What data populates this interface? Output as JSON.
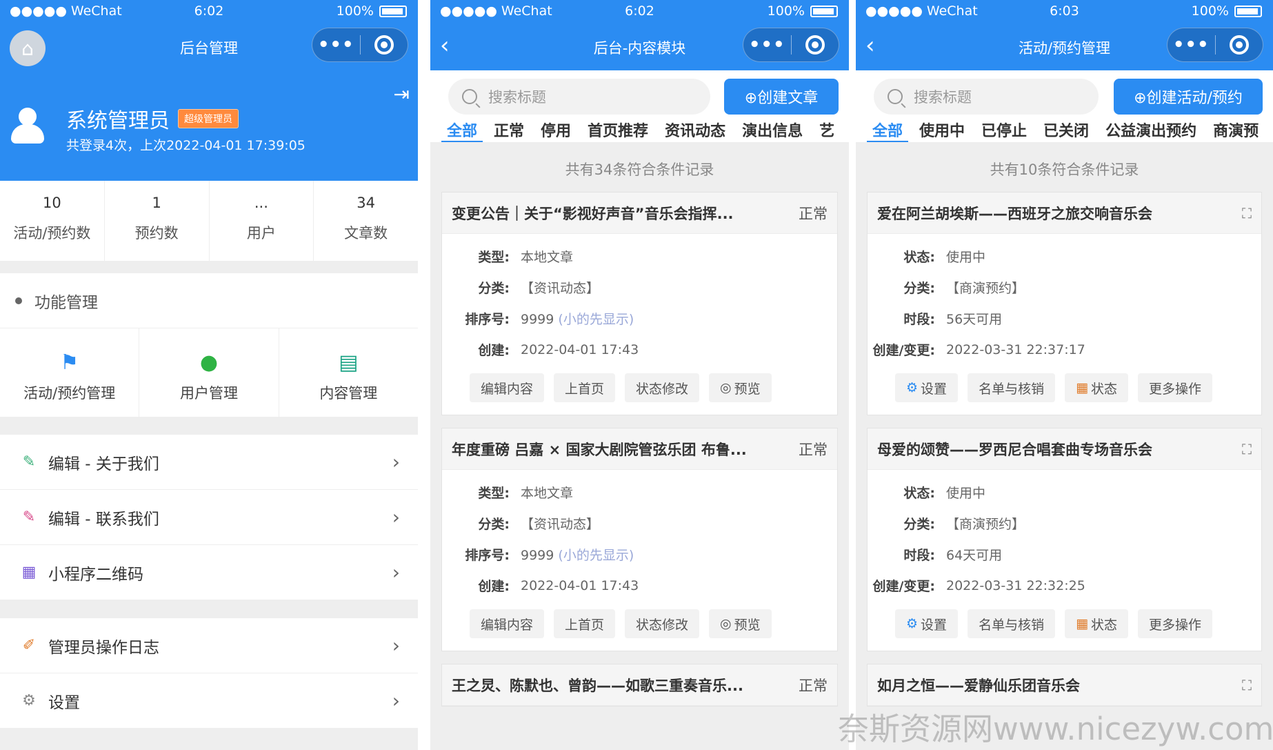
{
  "status_bars": [
    {
      "carrier": "●●●●● WeChat",
      "time": "6:02",
      "battery": "100%"
    },
    {
      "carrier": "●●●●● WeChat",
      "time": "6:02",
      "battery": "100%"
    },
    {
      "carrier": "●●●●● WeChat",
      "time": "6:03",
      "battery": "100%"
    }
  ],
  "capsule": {
    "more": "•••",
    "close": ""
  },
  "p1": {
    "title": "后台管理",
    "user": {
      "name": "系统管理员",
      "badge": "超级管理员",
      "info": "共登录4次，上次2022-04-01 17:39:05"
    },
    "stats": [
      {
        "value": "10",
        "label": "活动/预约数"
      },
      {
        "value": "1",
        "label": "预约数"
      },
      {
        "value": "...",
        "label": "用户"
      },
      {
        "value": "34",
        "label": "文章数"
      }
    ],
    "section": "功能管理",
    "funcs": [
      {
        "label": "活动/预约管理",
        "icon": "flag-icon",
        "color": "#2b8cf2"
      },
      {
        "label": "用户管理",
        "icon": "user-icon",
        "color": "#2fb344"
      },
      {
        "label": "内容管理",
        "icon": "news-icon",
        "color": "#1aa384"
      }
    ],
    "menu1": [
      {
        "label": "编辑 - 关于我们",
        "icon": "edit-icon",
        "color": "#3bb07a"
      },
      {
        "label": "编辑 - 联系我们",
        "icon": "edit-icon",
        "color": "#d84a8a"
      },
      {
        "label": "小程序二维码",
        "icon": "qrcode-icon",
        "color": "#7b5cd6"
      }
    ],
    "menu2": [
      {
        "label": "管理员操作日志",
        "icon": "log-icon",
        "color": "#e07b2a"
      },
      {
        "label": "设置",
        "icon": "gear-icon",
        "color": "#888888"
      }
    ]
  },
  "p2": {
    "title": "后台-内容模块",
    "search_placeholder": "搜索标题",
    "create": "⊕创建文章",
    "tabs": [
      "全部",
      "正常",
      "停用",
      "首页推荐",
      "资讯动态",
      "演出信息",
      "艺"
    ],
    "count": "共有34条符合条件记录",
    "labels": {
      "type": "类型:",
      "cate": "分类:",
      "order": "排序号:",
      "created": "创建:"
    },
    "cards": [
      {
        "title": "变更公告｜关于“影视好声音”音乐会指挥...",
        "status": "正常",
        "type": "本地文章",
        "cate": "【资讯动态】",
        "order": "9999",
        "order_hint": "(小的先显示)",
        "created": "2022-04-01 17:43"
      },
      {
        "title": "年度重磅 吕嘉 × 国家大剧院管弦乐团 布鲁...",
        "status": "正常",
        "type": "本地文章",
        "cate": "【资讯动态】",
        "order": "9999",
        "order_hint": "(小的先显示)",
        "created": "2022-04-01 17:43"
      },
      {
        "title": "王之炅、陈默也、曾韵——如歌三重奏音乐...",
        "status": "正常"
      }
    ],
    "buttons": [
      "编辑内容",
      "上首页",
      "状态修改",
      "预览"
    ]
  },
  "p3": {
    "title": "活动/预约管理",
    "search_placeholder": "搜索标题",
    "create": "⊕创建活动/预约",
    "tabs": [
      "全部",
      "使用中",
      "已停止",
      "已关闭",
      "公益演出预约",
      "商演预"
    ],
    "count": "共有10条符合条件记录",
    "labels": {
      "state": "状态:",
      "cate": "分类:",
      "period": "时段:",
      "changed": "创建/变更:"
    },
    "cards": [
      {
        "title": "爱在阿兰胡埃斯——西班牙之旅交响音乐会",
        "state": "使用中",
        "cate": "【商演预约】",
        "period": "56天可用",
        "changed": "2022-03-31 22:37:17"
      },
      {
        "title": "母爱的颂赞——罗西尼合唱套曲专场音乐会",
        "state": "使用中",
        "cate": "【商演预约】",
        "period": "64天可用",
        "changed": "2022-03-31 22:32:25"
      },
      {
        "title": "如月之恒——爱静仙乐团音乐会"
      }
    ],
    "buttons": [
      "设置",
      "名单与核销",
      "状态",
      "更多操作"
    ]
  },
  "watermark": "奈斯资源网www.nicezyw.com"
}
